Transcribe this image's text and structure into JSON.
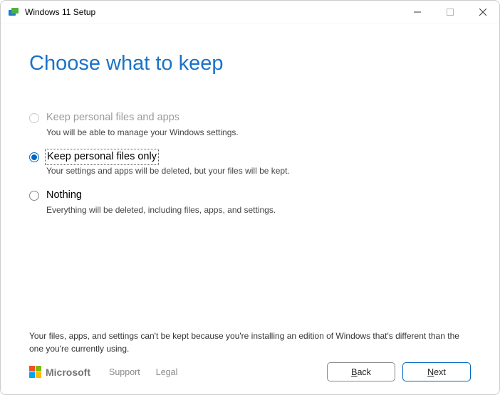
{
  "window": {
    "title": "Windows 11 Setup"
  },
  "page": {
    "heading": "Choose what to keep"
  },
  "options": [
    {
      "label": "Keep personal files and apps",
      "description": "You will be able to manage your Windows settings.",
      "state": "disabled"
    },
    {
      "label": "Keep personal files only",
      "description": "Your settings and apps will be deleted, but your files will be kept.",
      "state": "selected"
    },
    {
      "label": "Nothing",
      "description": "Everything will be deleted, including files, apps, and settings.",
      "state": "enabled"
    }
  ],
  "warning": "Your files, apps, and settings can't be kept because you're installing an edition of Windows that's different than the one you're currently using.",
  "footer": {
    "brand": "Microsoft",
    "links": {
      "support": "Support",
      "legal": "Legal"
    },
    "buttons": {
      "back": "Back",
      "next": "Next"
    }
  }
}
